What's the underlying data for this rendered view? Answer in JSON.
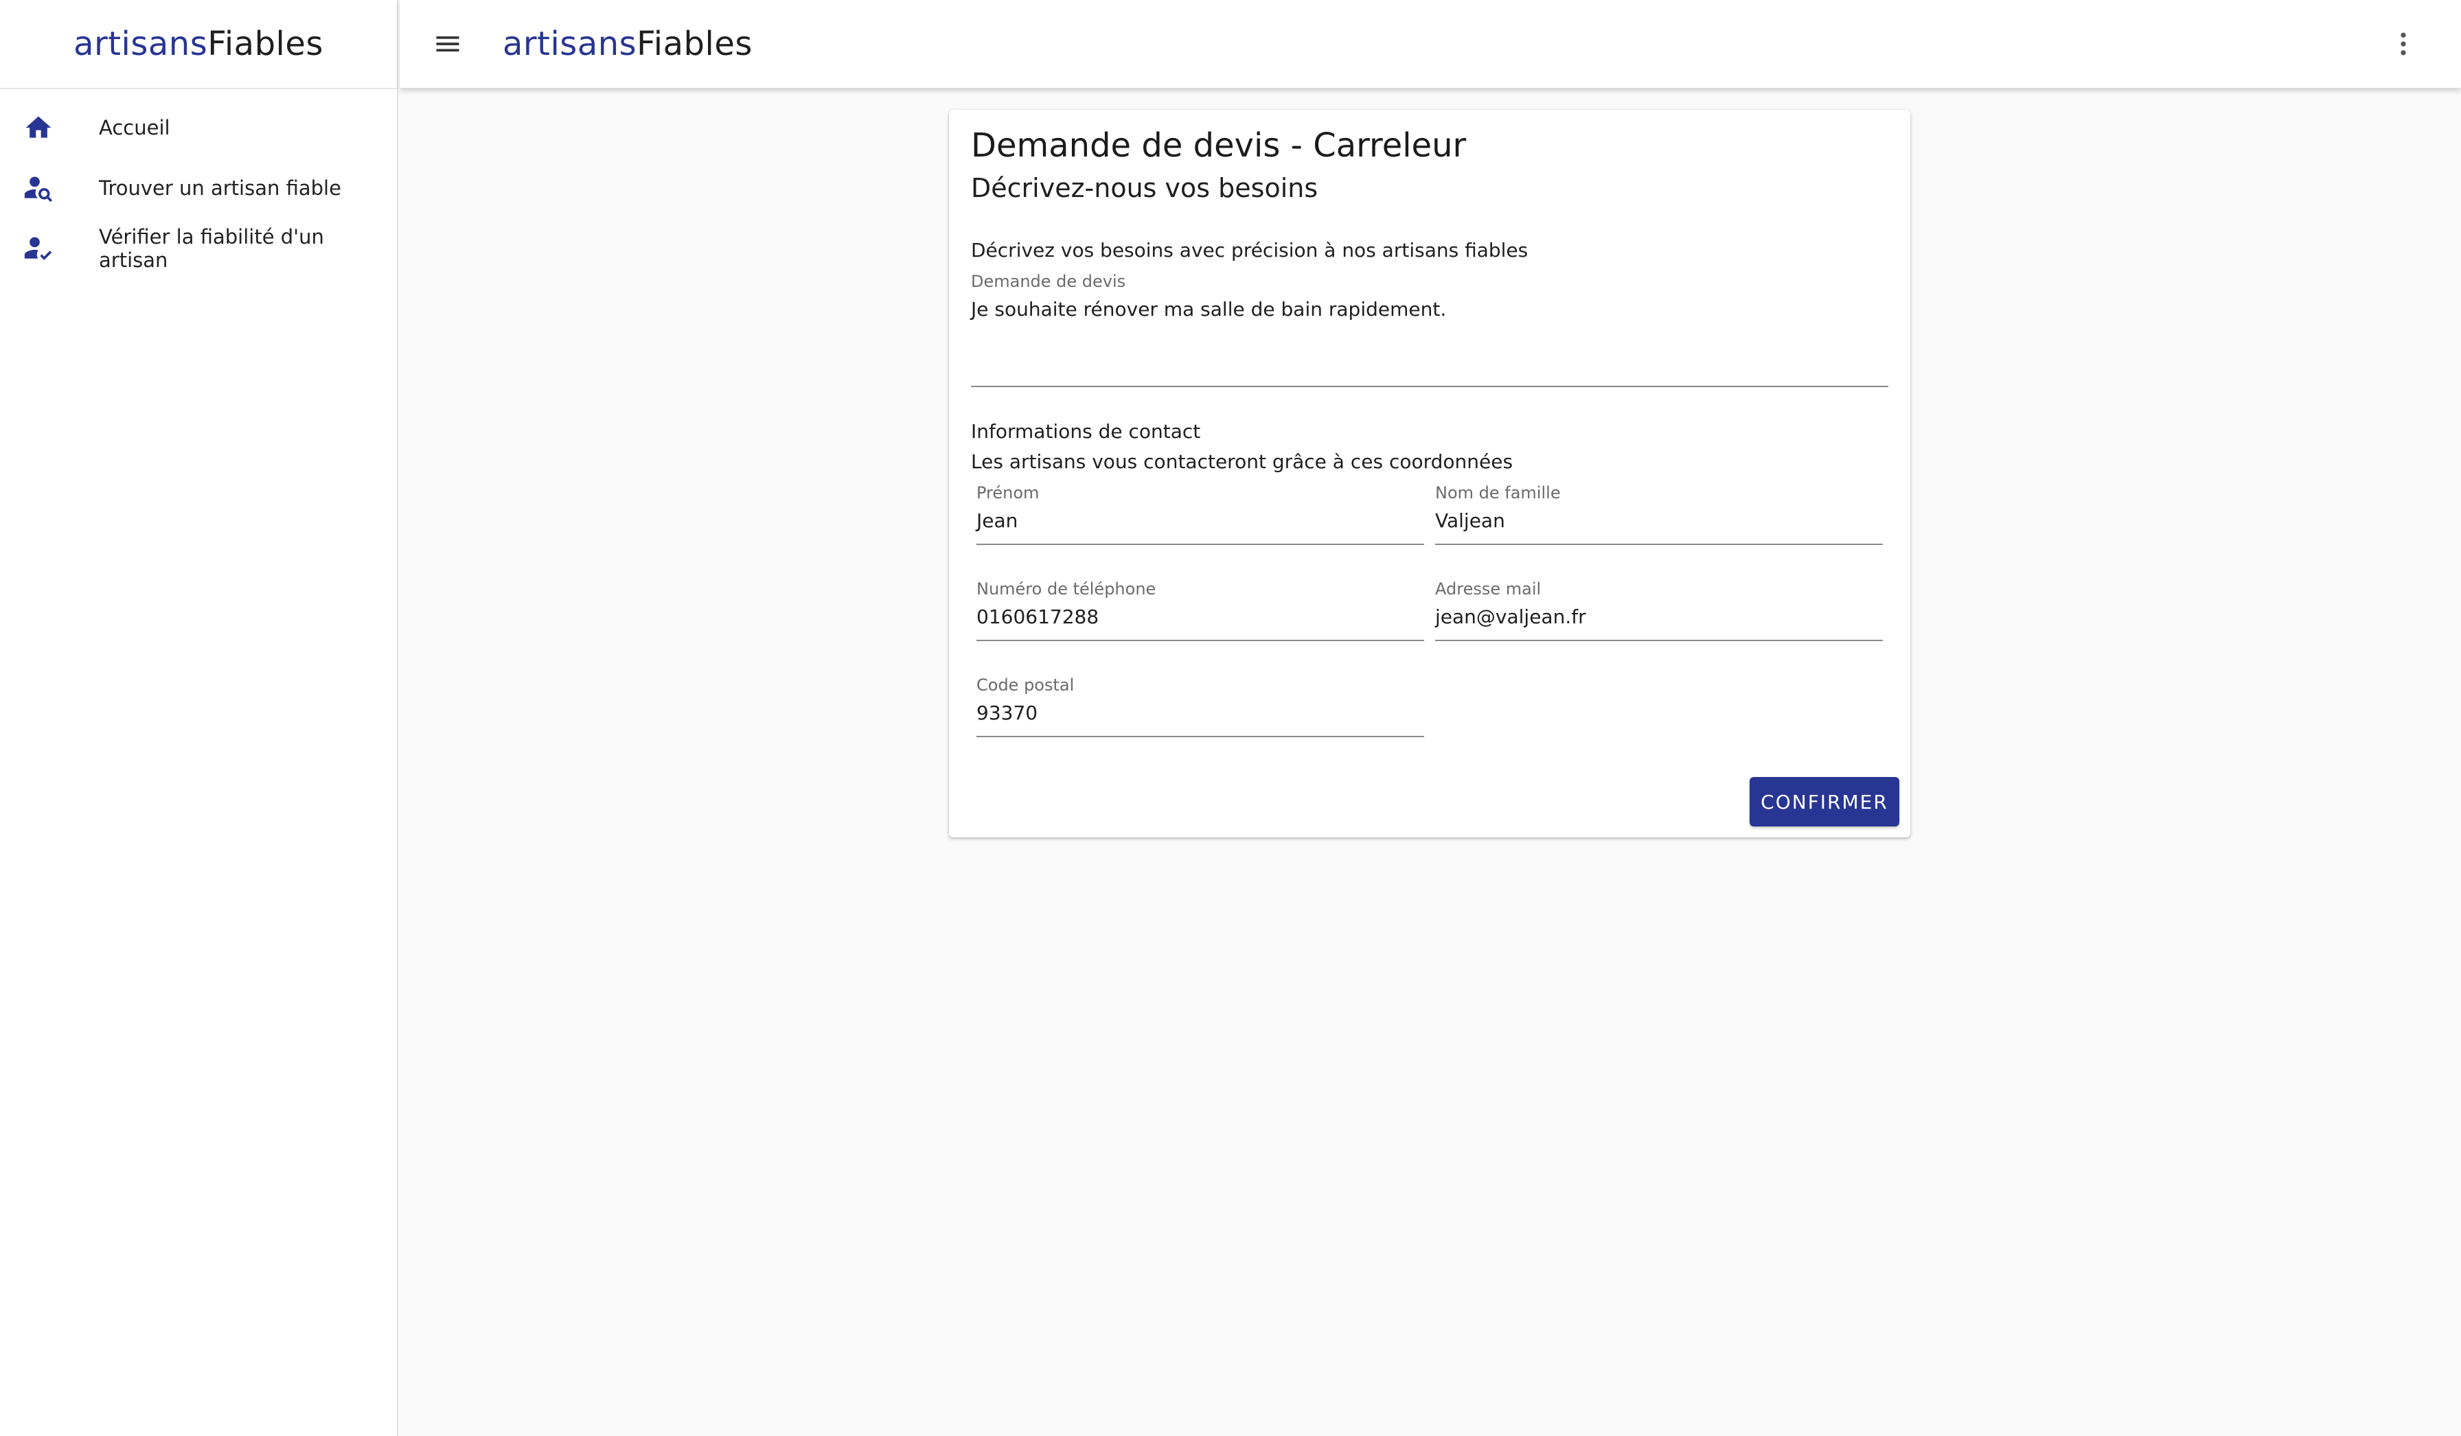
{
  "app": {
    "logo_part1": "artisans",
    "logo_part2": "Fiables"
  },
  "sidebar": {
    "items": [
      {
        "label": "Accueil",
        "icon": "home-icon"
      },
      {
        "label": "Trouver un artisan fiable",
        "icon": "person-search-icon"
      },
      {
        "label": "Vérifier la fiabilité d'un artisan",
        "icon": "person-check-icon"
      }
    ]
  },
  "topbar": {
    "menu_icon": "menu-icon",
    "more_icon": "more-vert-icon"
  },
  "form": {
    "title": "Demande de devis - Carreleur",
    "subtitle": "Décrivez-nous vos besoins",
    "intro": "Décrivez vos besoins avec précision à nos artisans fiables",
    "request": {
      "label": "Demande de devis",
      "value": "Je souhaite rénover ma salle de bain rapidement."
    },
    "contact_title": "Informations de contact",
    "contact_subtitle": "Les artisans vous contacteront grâce à ces coordonnées",
    "fields": {
      "first_name": {
        "label": "Prénom",
        "value": "Jean"
      },
      "last_name": {
        "label": "Nom de famille",
        "value": "Valjean"
      },
      "phone": {
        "label": "Numéro de téléphone",
        "value": "0160617288"
      },
      "email": {
        "label": "Adresse mail",
        "value": "jean@valjean.fr"
      },
      "postal_code": {
        "label": "Code postal",
        "value": "93370"
      }
    },
    "confirm_label": "CONFIRMER"
  },
  "colors": {
    "accent": "#283593",
    "background": "#fafafa"
  }
}
